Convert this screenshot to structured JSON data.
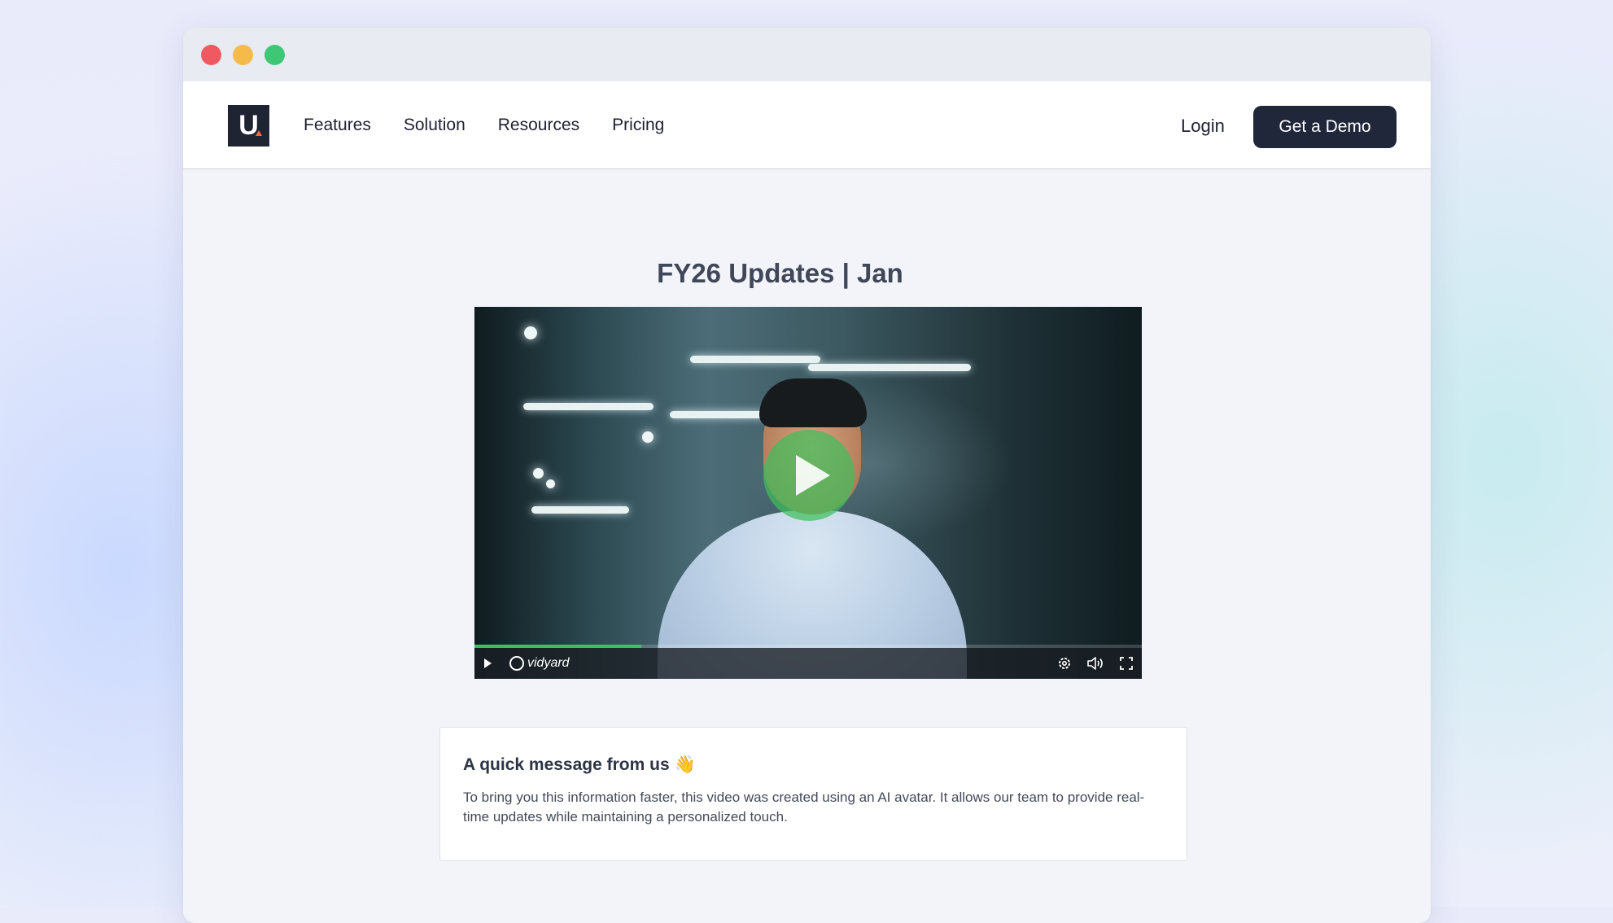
{
  "nav": {
    "logo_text": "U",
    "links": [
      "Features",
      "Solution",
      "Resources",
      "Pricing"
    ],
    "login_label": "Login",
    "demo_label": "Get a Demo"
  },
  "page": {
    "title": "FY26 Updates | Jan"
  },
  "video": {
    "brand": "vidyard",
    "progress_fraction": 0.25,
    "colors": {
      "accent": "#3fbf63"
    },
    "icons": [
      "play-icon",
      "vidyard-logo-icon",
      "settings-icon",
      "volume-icon",
      "fullscreen-icon"
    ]
  },
  "message": {
    "title": "A quick message from us 👋",
    "body": "To bring you this information faster, this video was created using an AI avatar. It allows our team to provide real-time updates while maintaining a personalized touch."
  }
}
